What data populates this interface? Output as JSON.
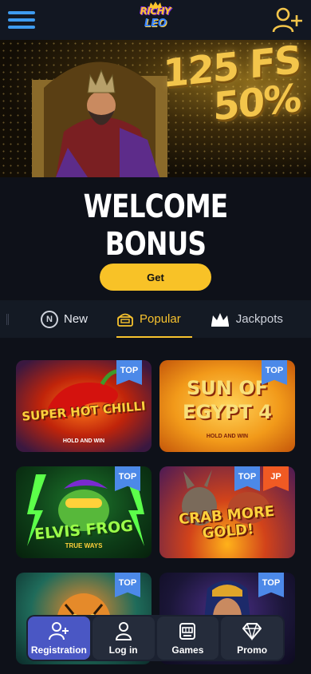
{
  "header": {
    "logo_top": "RICHY",
    "logo_bottom": "LEO"
  },
  "banner": {
    "offer_line1": "125 FS",
    "offer_line2": "50%"
  },
  "welcome": {
    "title_line1": "WELCOME",
    "title_line2": "BONUS",
    "get_label": "Get"
  },
  "tabs": [
    {
      "label": "New",
      "icon": "n-circle-icon"
    },
    {
      "label": "Popular",
      "icon": "treasure-chest-icon",
      "active": true
    },
    {
      "label": "Jackpots",
      "icon": "crown-icon"
    }
  ],
  "games": [
    {
      "title": "SUPER HOT CHILLI",
      "subtitle": "HOLD AND WIN",
      "badges": [
        "TOP"
      ]
    },
    {
      "title": "SUN OF EGYPT 4",
      "subtitle": "HOLD AND WIN",
      "badges": [
        "TOP"
      ]
    },
    {
      "title": "ELVIS FROG",
      "subtitle": "TRUE WAYS",
      "badges": [
        "TOP"
      ]
    },
    {
      "title": "CRAB MORE GOLD!",
      "subtitle": "",
      "badges": [
        "TOP",
        "JP"
      ]
    },
    {
      "title": "",
      "subtitle": "",
      "badges": [
        "TOP"
      ]
    },
    {
      "title": "",
      "subtitle": "",
      "badges": [
        "TOP"
      ]
    }
  ],
  "bottom_nav": [
    {
      "label": "Registration",
      "icon": "add-user-icon",
      "active": true
    },
    {
      "label": "Log in",
      "icon": "user-icon"
    },
    {
      "label": "Games",
      "icon": "slot-machine-icon"
    },
    {
      "label": "Promo",
      "icon": "diamond-icon"
    }
  ],
  "colors": {
    "accent": "#f8c227",
    "nav_active": "#4a57c4",
    "badge_top": "#4c89e8",
    "badge_jp": "#f05a23",
    "background": "#0e1119"
  }
}
